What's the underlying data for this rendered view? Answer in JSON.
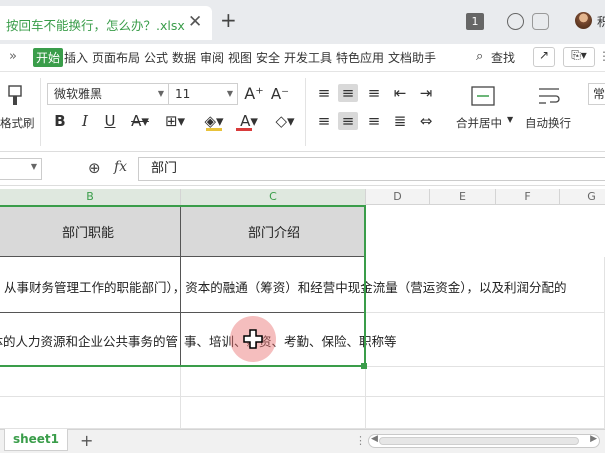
{
  "window": {
    "doc_tab_title": "按回车不能换行，怎么办？.xlsx",
    "window_count": "1",
    "user_name_partial": "积"
  },
  "menu": {
    "items": [
      "开始",
      "插入",
      "页面布局",
      "公式",
      "数据",
      "审阅",
      "视图",
      "安全",
      "开发工具",
      "特色应用",
      "文档助手"
    ],
    "overflow": "»",
    "search_label": "查找"
  },
  "ribbon": {
    "font_name": "微软雅黑",
    "font_size": "11",
    "format_brush_label": "格式刷",
    "merge_center_label": "合并居中",
    "wrap_text_label": "自动换行",
    "partial_right_label": "常"
  },
  "formula_bar": {
    "fx_label": "fx",
    "value": "部门"
  },
  "columns": [
    "B",
    "C",
    "D",
    "E",
    "F",
    "G"
  ],
  "cells": {
    "b_header": "部门职能",
    "c_header": "部门介绍",
    "row2_text": "从事财务管理工作的职能部门），资本的融通（筹资）和经营中现金流量（营运资金），以及利润分配的",
    "row3_b_text": "体的人力资源和企业公共事务的管",
    "row3_c_text": "事、培训、薪资、考勤、保险、职称等"
  },
  "sheets": {
    "active": "sheet1",
    "add_label": "+"
  },
  "colors": {
    "accent": "#3a9d4a",
    "header_fill": "#d9d9d9"
  }
}
